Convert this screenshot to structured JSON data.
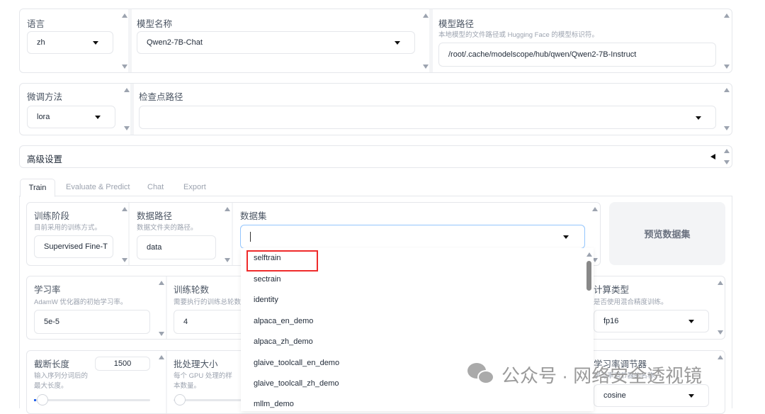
{
  "top": {
    "language": {
      "label": "语言",
      "value": "zh"
    },
    "model_name": {
      "label": "模型名称",
      "value": "Qwen2-7B-Chat"
    },
    "model_path": {
      "label": "模型路径",
      "hint": "本地模型的文件路径或 Hugging Face 的模型标识符。",
      "value": "/root/.cache/modelscope/hub/qwen/Qwen2-7B-Instruct"
    },
    "finetune": {
      "label": "微调方法",
      "value": "lora"
    },
    "checkpoint": {
      "label": "检查点路径",
      "value": ""
    },
    "advanced": {
      "label": "高级设置"
    }
  },
  "tabs": [
    {
      "label": "Train"
    },
    {
      "label": "Evaluate & Predict"
    },
    {
      "label": "Chat"
    },
    {
      "label": "Export"
    }
  ],
  "train": {
    "stage": {
      "label": "训练阶段",
      "hint": "目前采用的训练方式。",
      "value": "Supervised Fine-T"
    },
    "data_dir": {
      "label": "数据路径",
      "hint": "数据文件夹的路径。",
      "value": "data"
    },
    "dataset": {
      "label": "数据集",
      "value": ""
    },
    "preview_button": "预览数据集",
    "lr": {
      "label": "学习率",
      "hint": "AdamW 优化器的初始学习率。",
      "value": "5e-5"
    },
    "epochs": {
      "label": "训练轮数",
      "hint": "需要执行的训练总轮数。",
      "value": "4"
    },
    "compute": {
      "label": "计算类型",
      "hint": "是否使用混合精度训练。",
      "value": "fp16"
    },
    "cutoff": {
      "label": "截断长度",
      "hint1": "输入序列分词后的",
      "hint2": "最大长度。",
      "value": "1500"
    },
    "batch": {
      "label": "批处理大小",
      "hint1": "每个 GPU 处理的样",
      "hint2": "本数量。"
    },
    "scheduler": {
      "label": "学习率调节器",
      "hint": "学习率调节器的名称。",
      "value": "cosine"
    }
  },
  "dataset_options": [
    "selftrain",
    "sectrain",
    "identity",
    "alpaca_en_demo",
    "alpaca_zh_demo",
    "glaive_toolcall_en_demo",
    "glaive_toolcall_zh_demo",
    "mllm_demo"
  ],
  "watermark": "公众号 · 网络安全透视镜",
  "colors": {
    "highlight": "#ef2b2b",
    "focus": "#93c5fd"
  }
}
